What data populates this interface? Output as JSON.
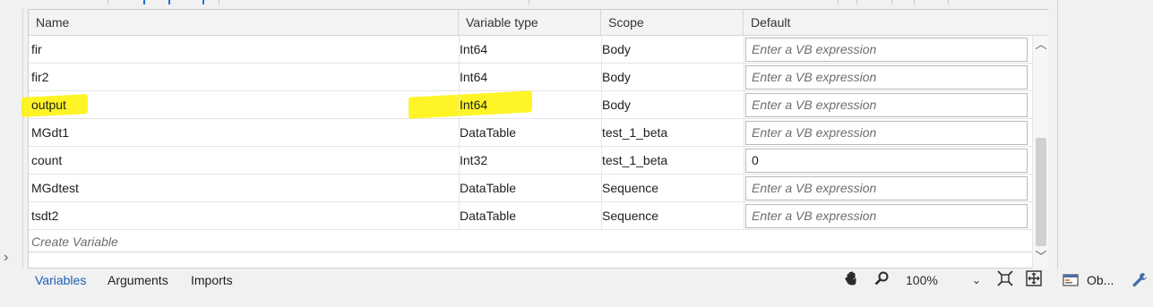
{
  "columns": {
    "name": "Name",
    "type": "Variable type",
    "scope": "Scope",
    "default": "Default"
  },
  "variables": [
    {
      "name": "fir",
      "type": "Int64",
      "scope": "Body",
      "default": "",
      "placeholder": "Enter a VB expression"
    },
    {
      "name": "fir2",
      "type": "Int64",
      "scope": "Body",
      "default": "",
      "placeholder": "Enter a VB expression"
    },
    {
      "name": "output",
      "type": "Int64",
      "scope": "Body",
      "default": "",
      "placeholder": "Enter a VB expression"
    },
    {
      "name": "MGdt1",
      "type": "DataTable",
      "scope": "test_1_beta",
      "default": "",
      "placeholder": "Enter a VB expression"
    },
    {
      "name": "count",
      "type": "Int32",
      "scope": "test_1_beta",
      "default": "0",
      "placeholder": "Enter a VB expression"
    },
    {
      "name": "MGdtest",
      "type": "DataTable",
      "scope": "Sequence",
      "default": "",
      "placeholder": "Enter a VB expression"
    },
    {
      "name": "tsdt2",
      "type": "DataTable",
      "scope": "Sequence",
      "default": "",
      "placeholder": "Enter a VB expression"
    }
  ],
  "create_variable": "Create Variable",
  "bottom_tabs": {
    "variables": "Variables",
    "arguments": "Arguments",
    "imports": "Imports"
  },
  "zoom": "100%",
  "right_tab_label": "Ob...",
  "icons": {
    "pan": "hand-icon",
    "zoom": "magnifier-icon",
    "zoom_dropdown": "chevron-down-icon",
    "fit": "fit-to-screen-icon",
    "overview": "overview-icon",
    "object_browser": "object-browser-icon",
    "properties": "wrench-icon"
  },
  "colors": {
    "highlight": "#fff200",
    "active_tab": "#1a5fb4",
    "placeholder": "#6d6d6d"
  }
}
